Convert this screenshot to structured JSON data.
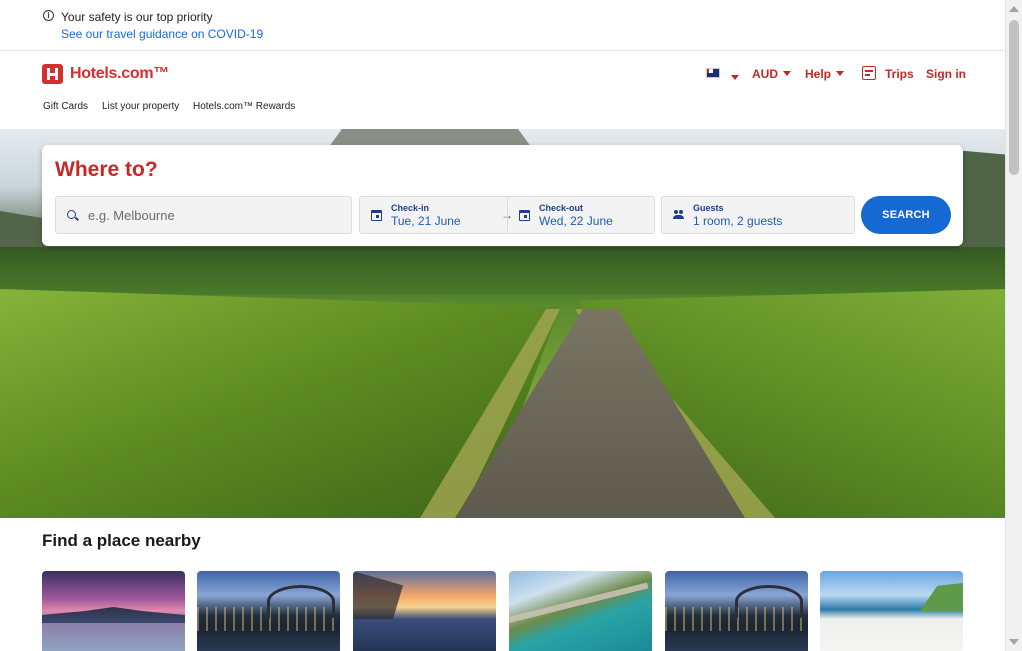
{
  "banner": {
    "title": "Your safety is our top priority",
    "link": "See our travel guidance on COVID-19"
  },
  "header": {
    "logo": "Hotels.com™",
    "currency": "AUD",
    "help": "Help",
    "trips": "Trips",
    "sign_in": "Sign in",
    "links": [
      "Gift Cards",
      "List your property",
      "Hotels.com™ Rewards"
    ]
  },
  "search": {
    "title": "Where to?",
    "destination_placeholder": "e.g. Melbourne",
    "checkin_label": "Check-in",
    "checkin_value": "Tue, 21 June",
    "checkout_label": "Check-out",
    "checkout_value": "Wed, 22 June",
    "guests_label": "Guests",
    "guests_value": "1 room, 2 guests",
    "button": "SEARCH"
  },
  "nearby": {
    "title": "Find a place nearby"
  },
  "colors": {
    "brand": "#d32f2f",
    "accent_blue": "#1668d3"
  }
}
